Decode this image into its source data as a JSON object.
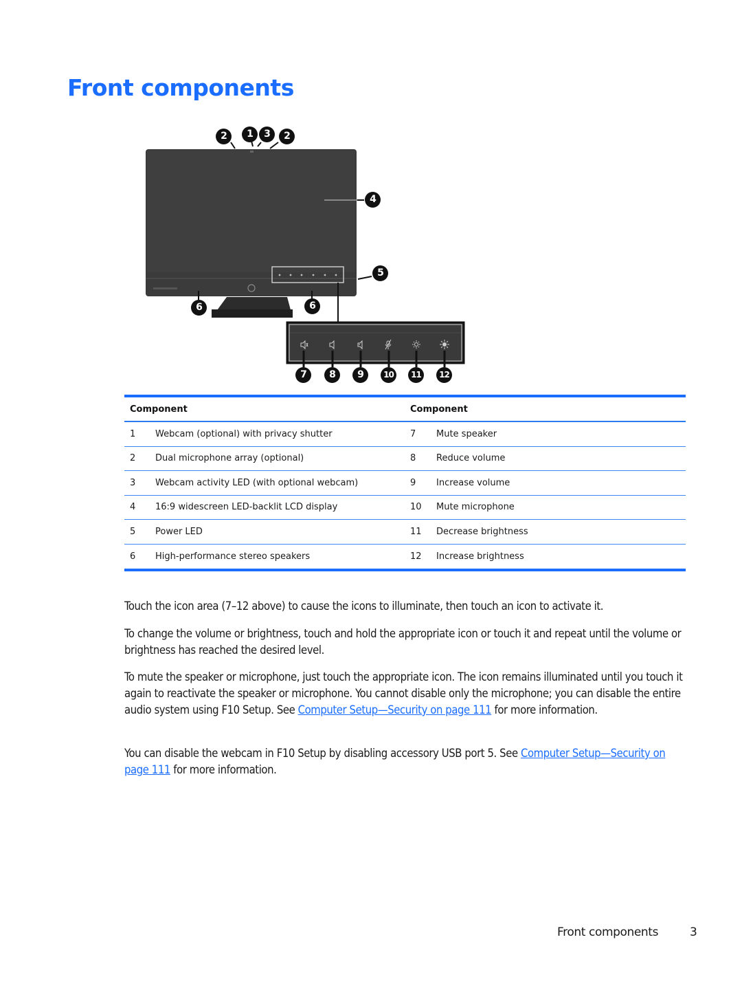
{
  "page": {
    "title": "Front components",
    "footer_section": "Front components",
    "footer_page_number": "3"
  },
  "figure": {
    "callouts": {
      "top": [
        "2",
        "1",
        "3",
        "2"
      ],
      "display": "4",
      "power_led": "5",
      "speakers": [
        "6",
        "6"
      ],
      "icons": [
        "7",
        "8",
        "9",
        "10",
        "11",
        "12"
      ]
    },
    "icon_panel_icons": [
      "mute-speaker-icon",
      "volume-down-icon",
      "volume-up-icon",
      "mute-microphone-icon",
      "brightness-down-icon",
      "brightness-up-icon"
    ]
  },
  "table": {
    "header_left": "Component",
    "header_right": "Component",
    "rows": [
      {
        "left_num": "1",
        "left_label": "Webcam (optional) with privacy shutter",
        "right_num": "7",
        "right_label": "Mute speaker"
      },
      {
        "left_num": "2",
        "left_label": "Dual microphone array (optional)",
        "right_num": "8",
        "right_label": "Reduce volume"
      },
      {
        "left_num": "3",
        "left_label": "Webcam activity LED (with optional webcam)",
        "right_num": "9",
        "right_label": "Increase volume"
      },
      {
        "left_num": "4",
        "left_label": "16:9 widescreen LED-backlit LCD display",
        "right_num": "10",
        "right_label": "Mute microphone"
      },
      {
        "left_num": "5",
        "left_label": "Power LED",
        "right_num": "11",
        "right_label": "Decrease brightness"
      },
      {
        "left_num": "6",
        "left_label": "High-performance stereo speakers",
        "right_num": "12",
        "right_label": "Increase brightness"
      }
    ]
  },
  "paragraphs": {
    "p1": "Touch the icon area (7–12 above) to cause the icons to illuminate, then touch an icon to activate it.",
    "p2": "To change the volume or brightness, touch and hold the appropriate icon or touch it and repeat until the volume or brightness has reached the desired level.",
    "p3_before": "To mute the speaker or microphone, just touch the appropriate icon. The icon remains illuminated until you touch it again to reactivate the speaker or microphone. You cannot disable only the microphone; you can disable the entire audio system using F10 Setup. See ",
    "p3_link": "Computer Setup—Security on page 111",
    "p3_after": " for more information.",
    "p4_before": "You can disable the webcam in F10 Setup by disabling accessory USB port 5. See ",
    "p4_link": "Computer Setup—Security on page 111",
    "p4_after": " for more information."
  },
  "colors": {
    "accent": "#1a6dff",
    "rule": "#3d86f2",
    "bezel": "#3a3a3a"
  }
}
